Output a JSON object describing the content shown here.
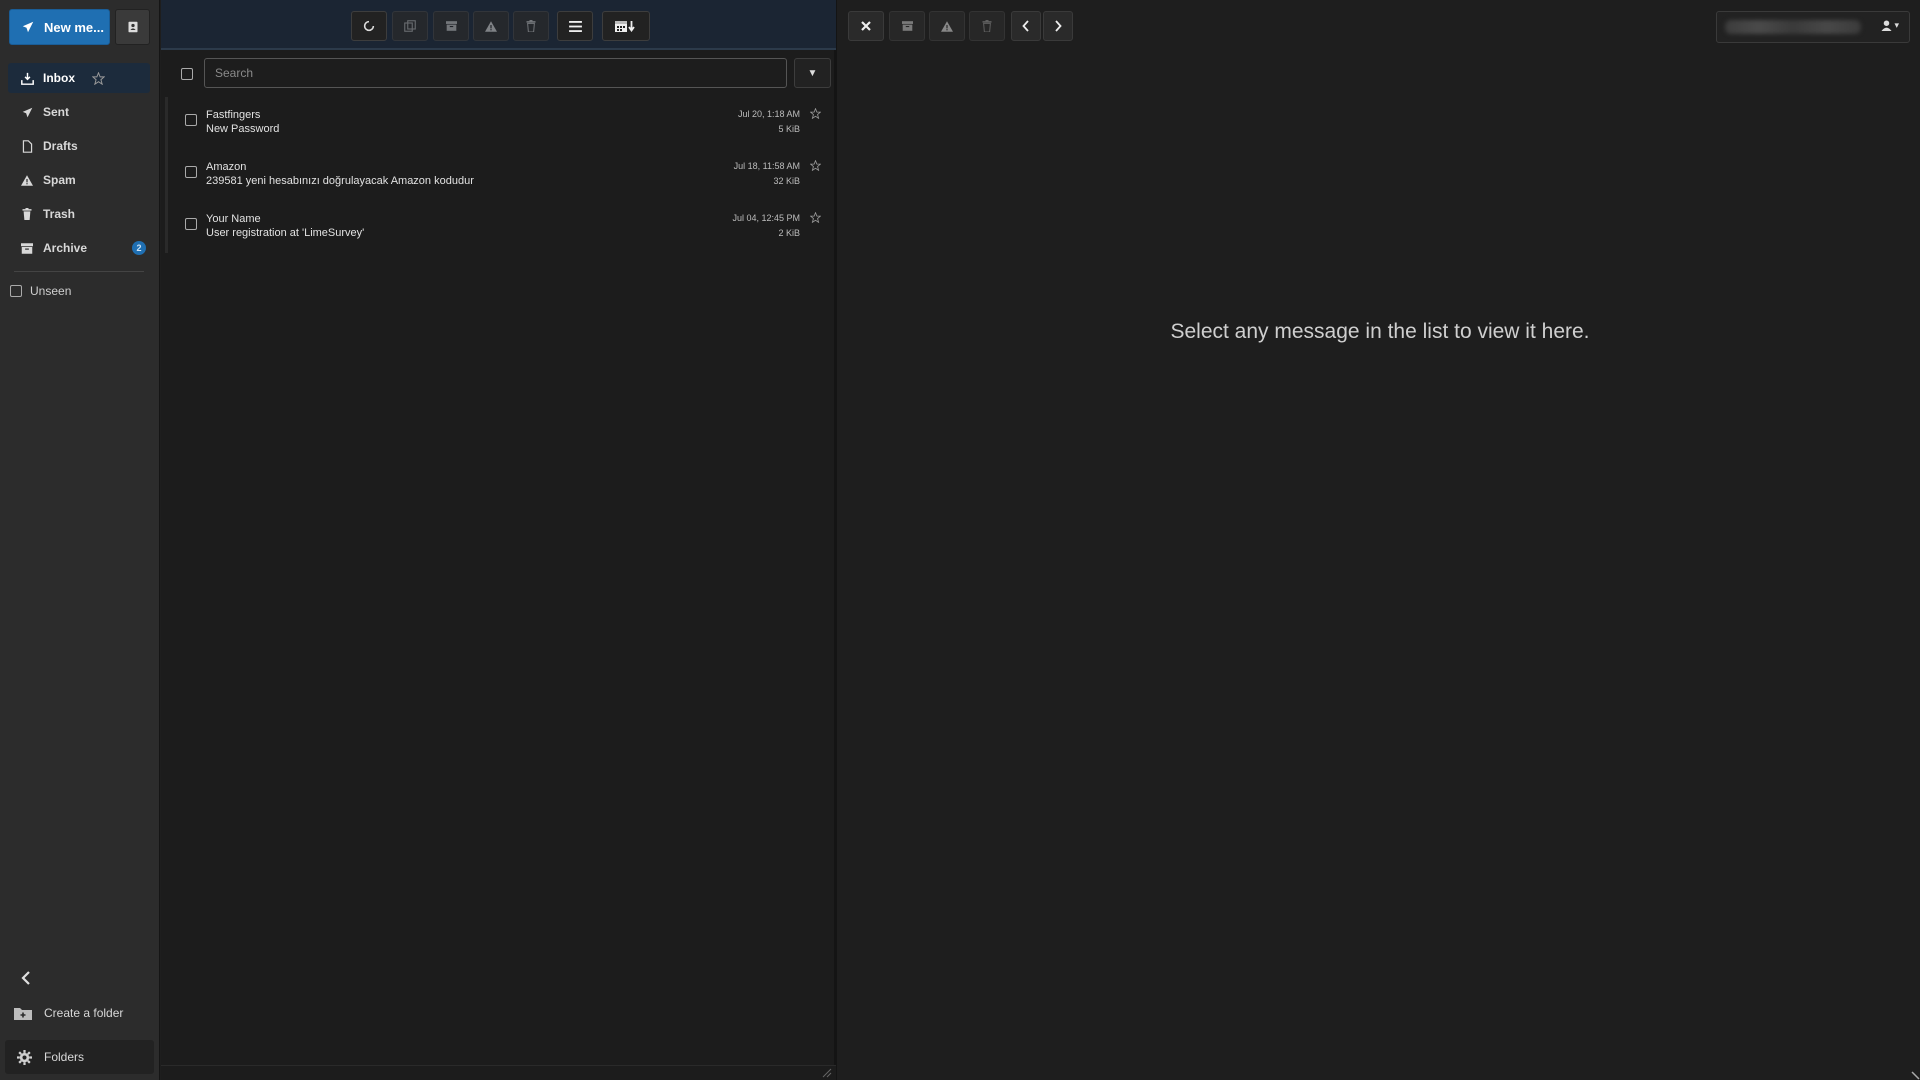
{
  "sidebar": {
    "new_message_label": "New me...",
    "items": [
      {
        "label": "Inbox",
        "icon": "inbox-icon"
      },
      {
        "label": "Sent",
        "icon": "paper-plane-icon"
      },
      {
        "label": "Drafts",
        "icon": "file-icon"
      },
      {
        "label": "Spam",
        "icon": "warning-icon"
      },
      {
        "label": "Trash",
        "icon": "trash-icon"
      },
      {
        "label": "Archive",
        "icon": "archive-icon",
        "badge": "2"
      }
    ],
    "unseen_label": "Unseen",
    "create_folder_label": "Create a folder",
    "folders_label": "Folders"
  },
  "search": {
    "placeholder": "Search",
    "dropdown_glyph": "▼"
  },
  "messages": [
    {
      "from": "Fastfingers",
      "subject": "New Password",
      "date": "Jul 20, 1:18 AM",
      "size": "5 KiB"
    },
    {
      "from": "Amazon",
      "subject": "239581 yeni hesabınızı doğrulayacak Amazon kodudur",
      "date": "Jul 18, 11:58 AM",
      "size": "32 KiB"
    },
    {
      "from": "Your Name",
      "subject": "User registration at 'LimeSurvey'",
      "date": "Jul 04, 12:45 PM",
      "size": "2 KiB"
    }
  ],
  "preview": {
    "empty_text": "Select any message in the list to view it here.",
    "account_caret": "▾"
  },
  "colors": {
    "accent": "#1f6fb2",
    "toolbar_bg": "#1b2533",
    "sidebar_bg": "#2c2c2c"
  }
}
